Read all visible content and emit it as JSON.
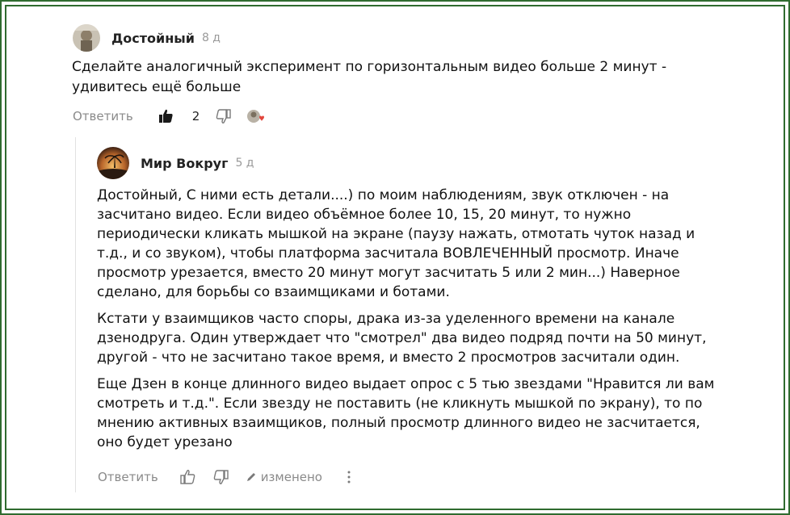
{
  "comment1": {
    "author": "Достойный",
    "ago": "8 д",
    "text": "Сделайте аналогичный эксперимент по горизонтальным видео больше 2 минут - удивитесь ещё больше",
    "actions": {
      "reply_label": "Ответить",
      "like_count": "2"
    },
    "icons": [
      "thumb-up-filled-icon",
      "thumb-down-icon",
      "reaction-avatar-heart-icon"
    ]
  },
  "comment2": {
    "author": "Мир Вокруг",
    "ago": "5 д",
    "paragraphs": [
      "Достойный, С ними есть детали....) по моим наблюдениям, звук отключен - на засчитано видео. Если видео объёмное более 10, 15, 20 минут, то нужно периодически кликать мышкой на экране (паузу нажать, отмотать чуток назад и т.д., и со звуком), чтобы платформа засчитала ВОВЛЕЧЕННЫЙ просмотр. Иначе просмотр урезается, вместо 20 минут могут засчитать 5 или 2 мин...) Наверное сделано, для борьбы со взаимщиками и ботами.",
      "Кстати у взаимщиков часто споры, драка из-за уделенного времени на канале дзенодруга. Один утверждает что \"смотрел\" два видео подряд почти на 50 минут, другой - что не засчитано такое время, и вместо 2 просмотров засчитали один.",
      "Еще Дзен в конце длинного видео выдает опрос с 5 тью звездами \"Нравится ли вам смотреть и т.д.\". Если звезду не поставить (не кликнуть мышкой по экрану), то по мнению активных взаимщиков, полный просмотр длинного видео не засчитается, оно будет урезано"
    ],
    "actions": {
      "reply_label": "Ответить",
      "edited_label": "изменено"
    },
    "icons": [
      "thumb-up-icon",
      "thumb-down-icon",
      "pencil-icon",
      "more-vertical-icon"
    ]
  },
  "colors": {
    "frame": "#2f6b2f",
    "muted": "#8a8a8a",
    "text": "#111111"
  }
}
